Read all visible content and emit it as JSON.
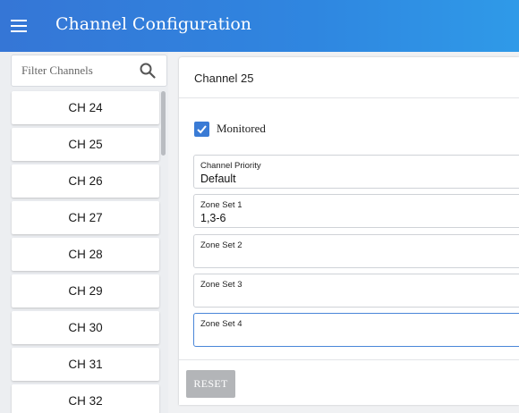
{
  "header": {
    "title": "Channel Configuration",
    "menu_icon": "hamburger-menu-icon"
  },
  "sidebar": {
    "search": {
      "placeholder": "Filter Channels",
      "value": "",
      "icon": "search-icon"
    },
    "channels": [
      "CH 24",
      "CH 25",
      "CH 26",
      "CH 27",
      "CH 28",
      "CH 29",
      "CH 30",
      "CH 31",
      "CH 32"
    ]
  },
  "panel": {
    "title": "Channel 25",
    "monitored": {
      "label": "Monitored",
      "checked": true
    },
    "fields": [
      {
        "label": "Channel Priority",
        "value": "Default"
      },
      {
        "label": "Zone Set 1",
        "value": "1,3-6"
      },
      {
        "label": "Zone Set 2",
        "value": ""
      },
      {
        "label": "Zone Set 3",
        "value": ""
      },
      {
        "label": "Zone Set 4",
        "value": ""
      }
    ],
    "reset_label": "RESET"
  },
  "colors": {
    "header_start": "#3576d6",
    "header_end": "#2f9ae8",
    "accent": "#3a7bd5",
    "reset_disabled": "#b3b5b8"
  }
}
